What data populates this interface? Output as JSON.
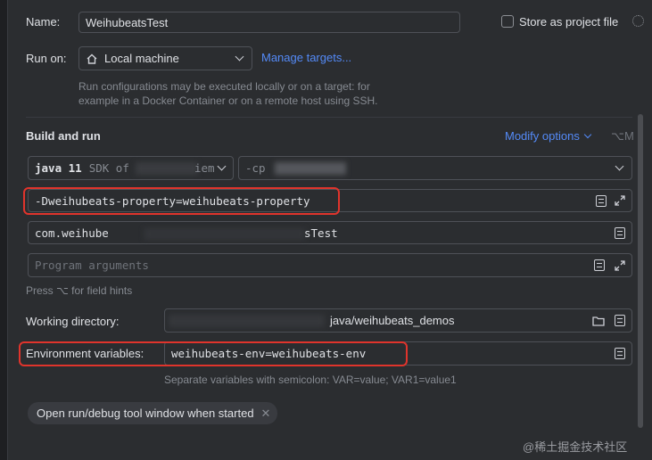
{
  "name": {
    "label": "Name:",
    "value": "WeihubeatsTest"
  },
  "store_project_file": {
    "label": "Store as project file",
    "checked": false
  },
  "run_on": {
    "label": "Run on:",
    "value": "Local machine",
    "manage_link": "Manage targets..."
  },
  "run_on_hint": {
    "line1": "Run configurations may be executed locally or on a target: for",
    "line2": "example in a Docker Container or on a remote host using SSH."
  },
  "build_and_run": {
    "title": "Build and run",
    "modify_options": "Modify options",
    "shortcut": "⌥M"
  },
  "sdk": {
    "value": "java 11",
    "detail": "SDK of",
    "detail_tail": "iem"
  },
  "classpath": {
    "value": "-cp"
  },
  "vm_options": {
    "value": "-Dweihubeats-property=weihubeats-property"
  },
  "main_class": {
    "value_start": "com.weihube",
    "value_end": "sTest"
  },
  "program_args": {
    "placeholder": "Program arguments"
  },
  "field_hint": "Press ⌥ for field hints",
  "working_directory": {
    "label": "Working directory:",
    "value": "java/weihubeats_demos"
  },
  "env_vars": {
    "label": "Environment variables:",
    "value": "weihubeats-env=weihubeats-env",
    "hint": "Separate variables with semicolon: VAR=value; VAR1=value1"
  },
  "open_tool_window": {
    "label": "Open run/debug tool window when started"
  },
  "watermark": "@稀土掘金技术社区",
  "colors": {
    "background": "#2b2d30",
    "accent": "#548af7",
    "highlight": "#e0342c"
  }
}
